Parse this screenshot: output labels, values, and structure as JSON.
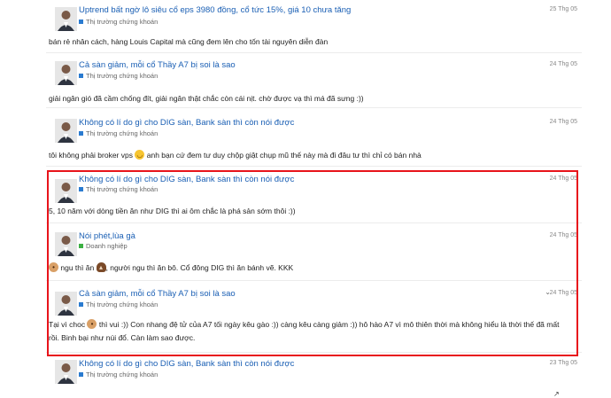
{
  "posts": [
    {
      "topic": "Uptrend bất ngờ lô siêu cổ eps 3980 đồng, cổ tức 15%, giá 10 chưa tăng",
      "category": "Thị trường chứng khoán",
      "category_color": "#2a7bd0",
      "date": "25 Thg 05",
      "body": "bán rẻ nhân cách, hàng Louis Capital mà cũng đem lên cho tốn tài nguyên diễn đàn"
    },
    {
      "topic": "Cả sàn giảm, mỗi cổ Thầy A7 bị soi là sao",
      "category": "Thị trường chứng khoán",
      "category_color": "#2a7bd0",
      "date": "24 Thg 05",
      "body": "giải ngân gió đã cầm chống đít, giải ngân thật chắc còn cái nịt. chờ được vạ thì má đã sưng :))"
    },
    {
      "topic": "Không có lí do gì cho DIG sàn, Bank sàn thì còn nói được",
      "category": "Thị trường chứng khoán",
      "category_color": "#2a7bd0",
      "date": "24 Thg 05",
      "body_before": "tôi không phải broker vps",
      "body_after": "anh bạn cứ đem tư duy chộp giật chụp mũ thế này mà đi đâu tư thì chỉ có bán nhà"
    },
    {
      "topic": "Không có lí do gì cho DIG sàn, Bank sàn thì còn nói được",
      "category": "Thị trường chứng khoán",
      "category_color": "#2a7bd0",
      "date": "24 Thg 05",
      "body": "5, 10 năm với dòng tiền ăn như DIG thì ai ôm chắc là phá sản sớm thôi :))"
    },
    {
      "topic": "Nói phét,lùa gà",
      "category": "Doanh nghiệp",
      "category_color": "#3cb043",
      "date": "24 Thg 05",
      "body_a": "ngu thì ăn",
      "body_b": ", người ngu thì ăn bô. Cổ đông DIG thì ăn bánh vẽ. KKK"
    },
    {
      "topic": "Cả sàn giảm, mỗi cổ Thầy A7 bị soi là sao",
      "category": "Thị trường chứng khoán",
      "category_color": "#2a7bd0",
      "date": "24 Thg 05",
      "body_a": "Tại vì choc",
      "body_b": "thì vui :)) Con nhang đệ tử của A7 tối ngày kêu gào :)) càng kêu càng giảm :)) hô hào A7 vì mô thiên thời mà không hiểu là thời thế đã mất rồi. Binh bại như núi đổ. Càn làm sao được."
    },
    {
      "topic": "Không có lí do gì cho DIG sàn, Bank sàn thì còn nói được",
      "category": "Thị trường chứng khoán",
      "category_color": "#2a7bd0",
      "date": "23 Thg 05"
    }
  ],
  "icons": {
    "slight_smile": "slight-smile-emoji",
    "dog": "dog-emoji",
    "poop": "poop-emoji",
    "chevron": "chevron-down-icon"
  },
  "accent": {
    "highlight_border": "#e8141b",
    "link": "#1a5fb4"
  }
}
